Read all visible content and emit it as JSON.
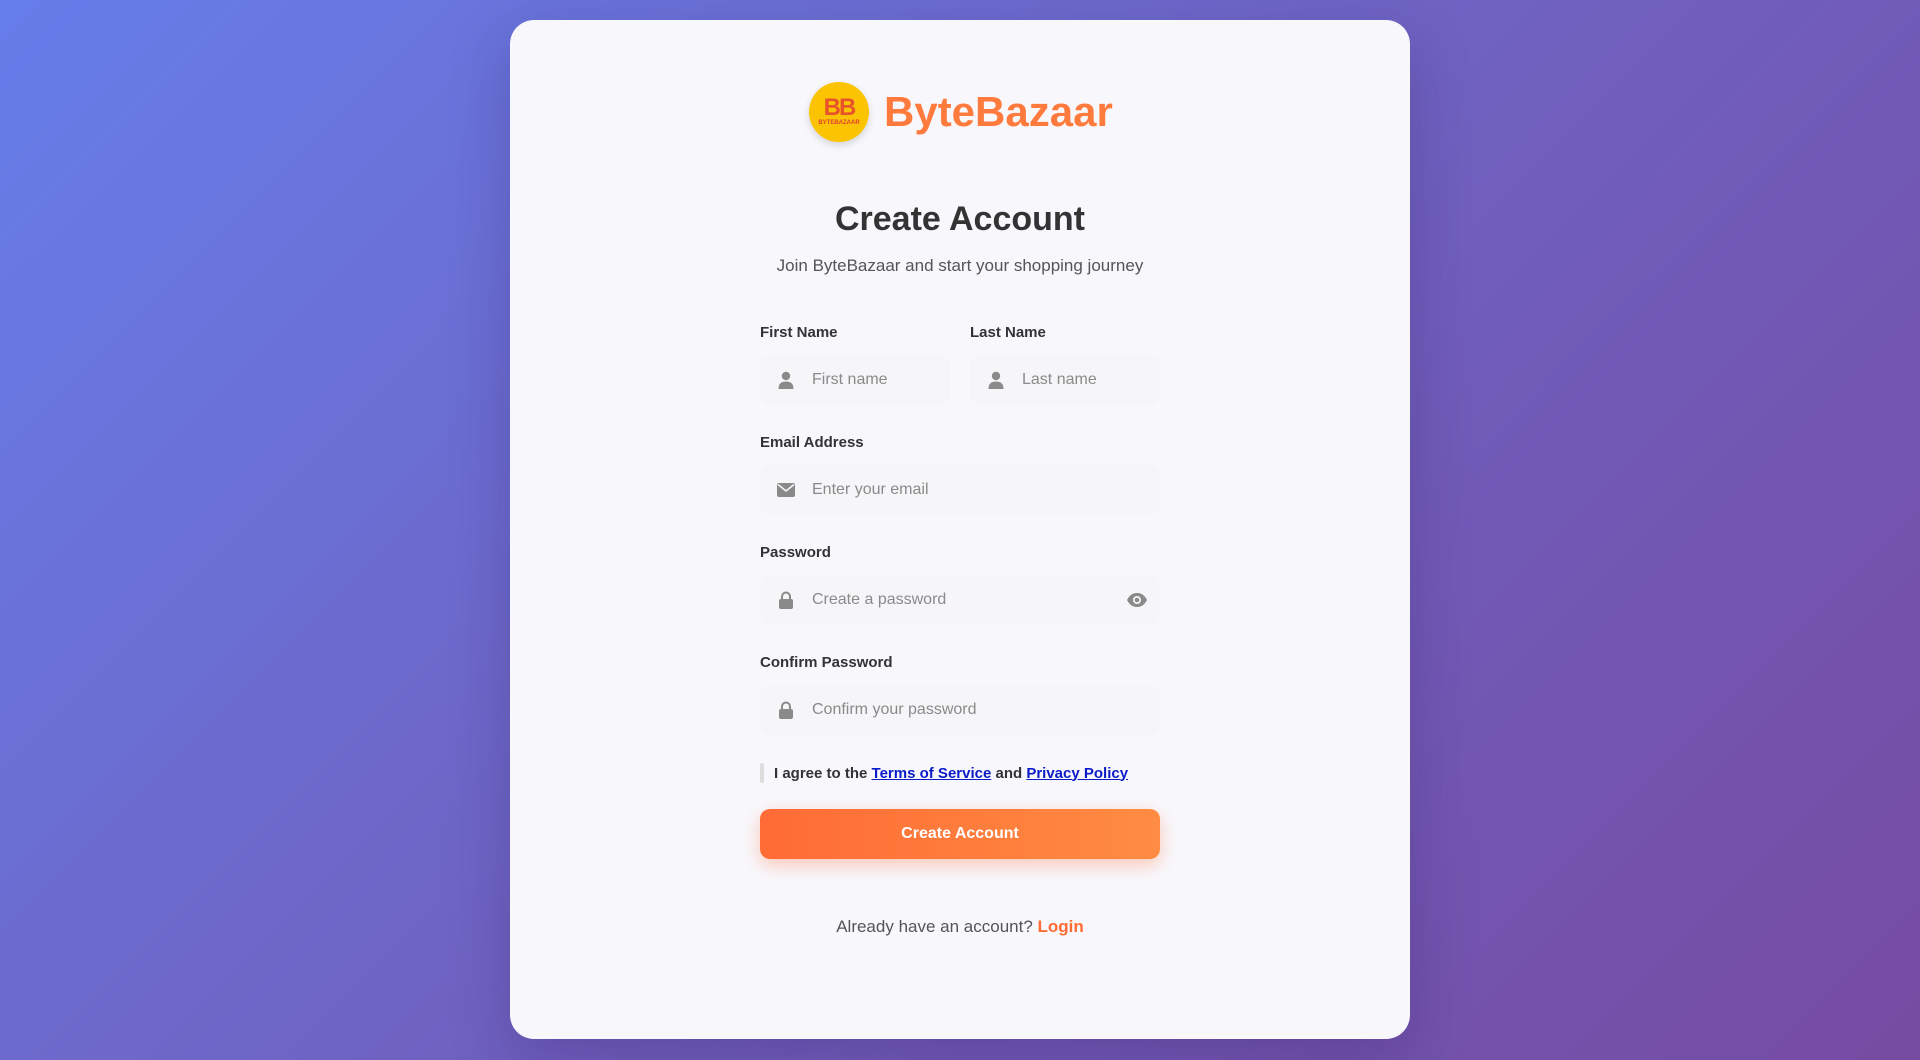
{
  "brand": {
    "logo_text": "BB",
    "logo_subtext": "BYTEBAZAAR",
    "name": "ByteBazaar",
    "accent_color": "#ff7a3d"
  },
  "heading": {
    "title": "Create Account",
    "subtitle": "Join ByteBazaar and start your shopping journey"
  },
  "form": {
    "first_name": {
      "label": "First Name",
      "placeholder": "First name",
      "icon": "user-icon"
    },
    "last_name": {
      "label": "Last Name",
      "placeholder": "Last name",
      "icon": "user-icon"
    },
    "email": {
      "label": "Email Address",
      "placeholder": "Enter your email",
      "icon": "envelope-icon"
    },
    "password": {
      "label": "Password",
      "placeholder": "Create a password",
      "icon": "lock-icon",
      "toggle_icon": "eye-icon"
    },
    "confirm_password": {
      "label": "Confirm Password",
      "placeholder": "Confirm your password",
      "icon": "lock-icon"
    },
    "terms": {
      "prefix": "I agree to the",
      "tos_link": "Terms of Service",
      "and": "and",
      "privacy_link": "Privacy Policy"
    },
    "submit_label": "Create Account"
  },
  "footer": {
    "prompt": "Already have an account?",
    "login_link": "Login"
  }
}
